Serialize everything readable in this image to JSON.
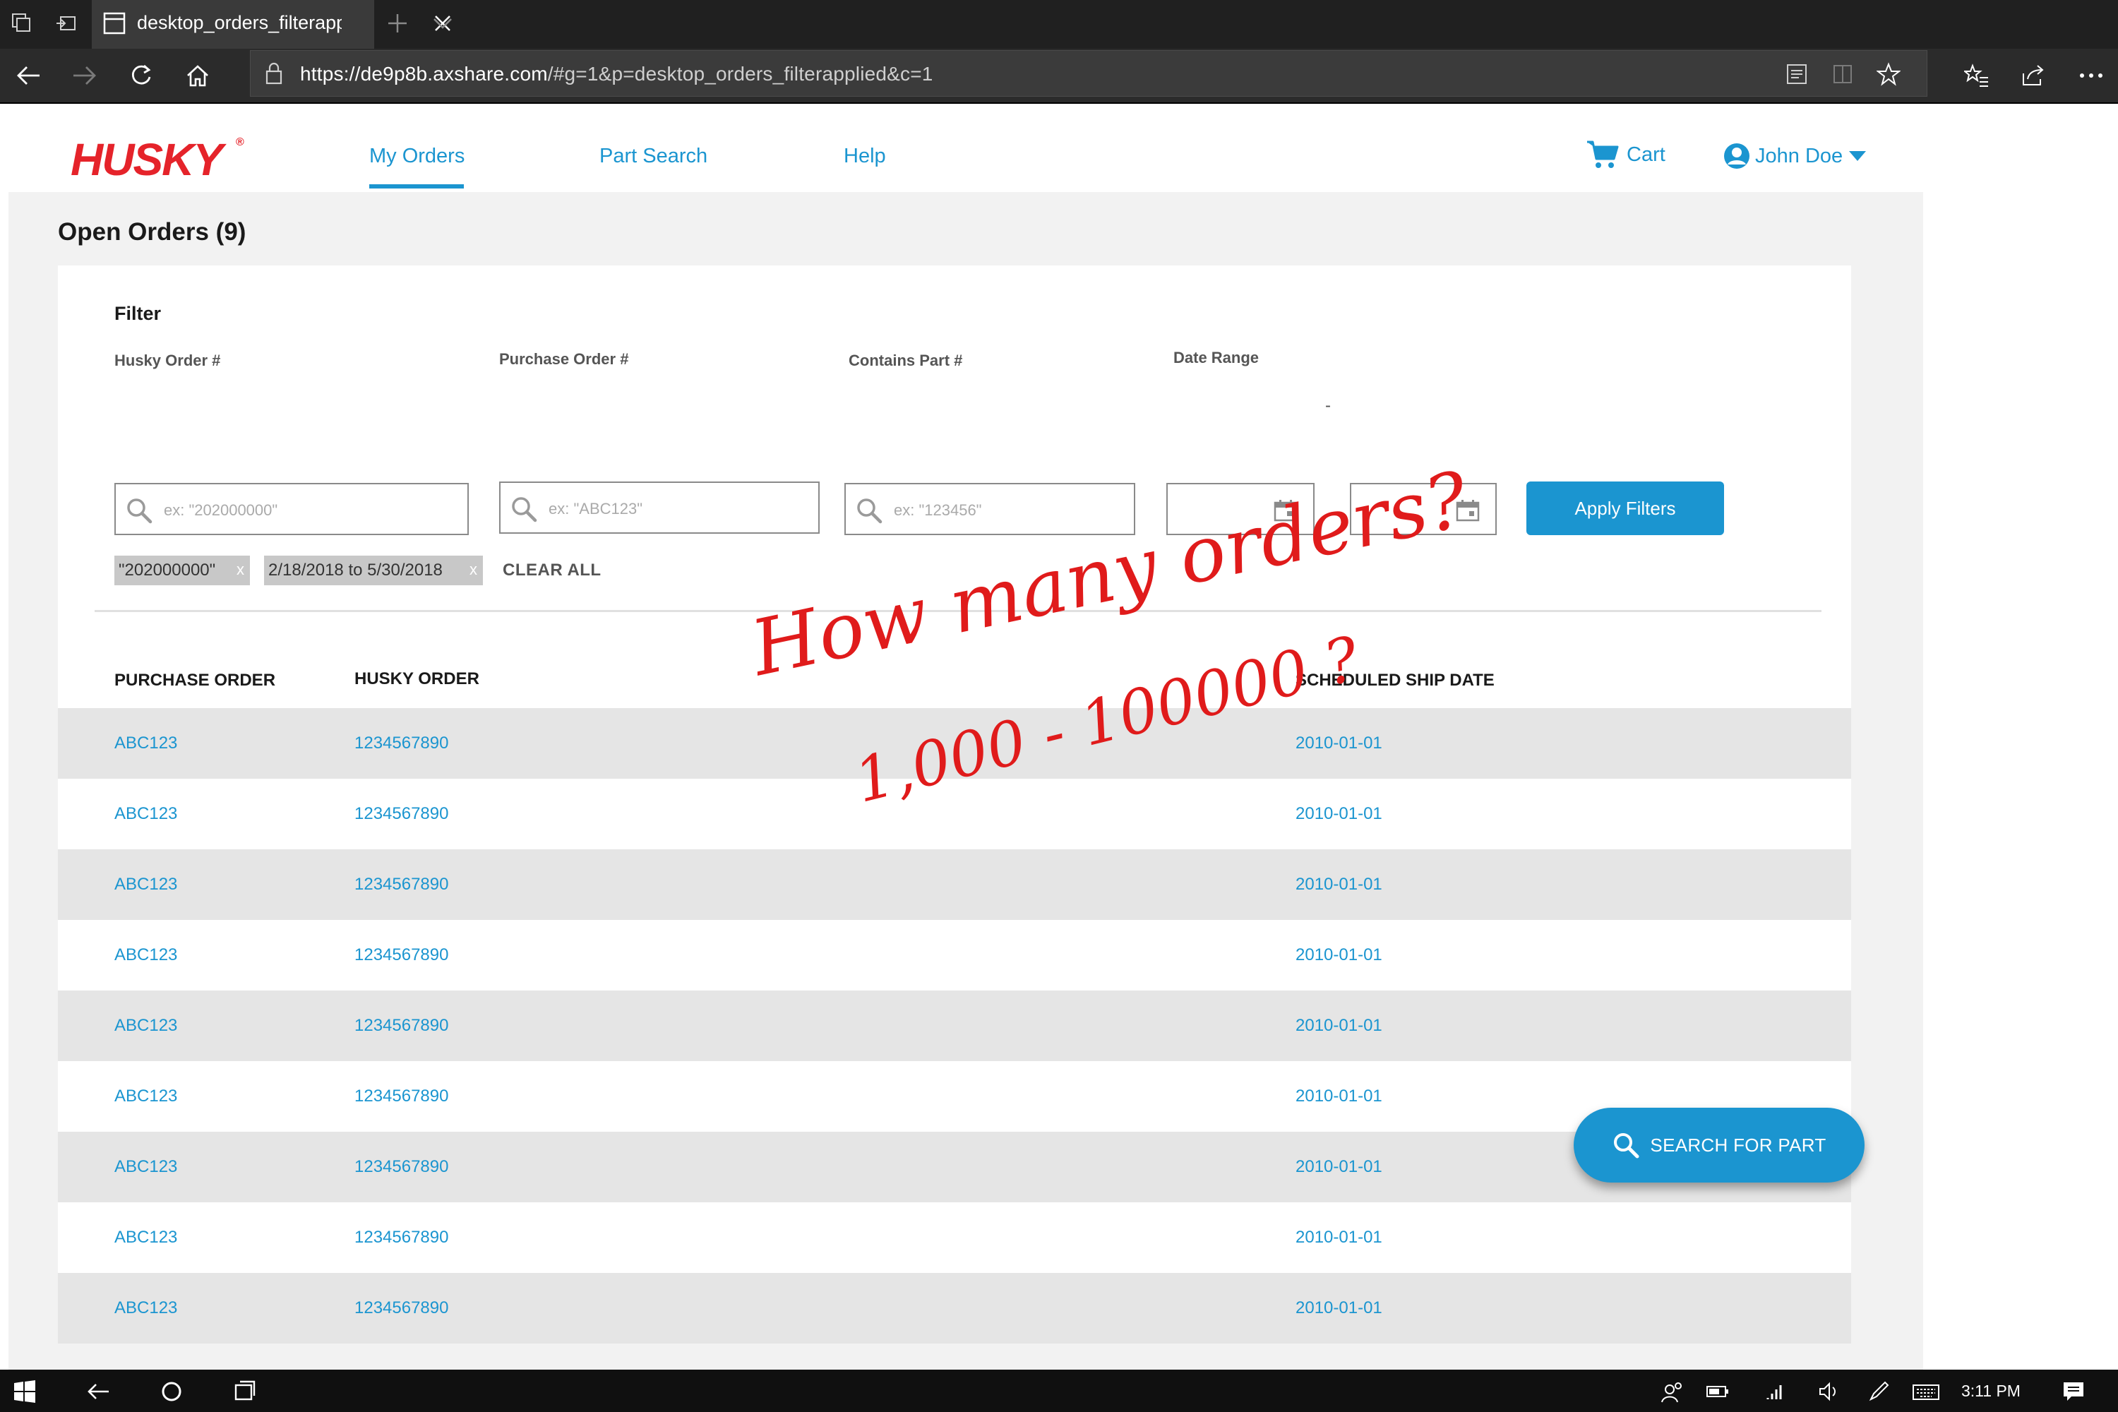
{
  "browser": {
    "tab_title": "desktop_orders_filterapp",
    "url_host": "https://de9p8b.axshare.com",
    "url_rest": "/#g=1&p=desktop_orders_filterapplied&c=1"
  },
  "header": {
    "logo": "HUSKY",
    "logo_mark": "®",
    "nav": [
      "My Orders",
      "Part Search",
      "Help"
    ],
    "active_nav": "My Orders",
    "cart_label": "Cart",
    "user_name": "John Doe"
  },
  "page": {
    "title": "Open Orders (9)"
  },
  "filter": {
    "title": "Filter",
    "husky_order_label": "Husky Order #",
    "husky_order_placeholder": "ex: \"202000000\"",
    "purchase_order_label": "Purchase Order #",
    "purchase_order_placeholder": "ex: \"ABC123\"",
    "contains_part_label": "Contains Part #",
    "contains_part_placeholder": "ex: \"123456\"",
    "date_range_label": "Date Range",
    "date_separator": "-",
    "apply_label": "Apply Filters",
    "chips": [
      {
        "label": "\"202000000\"",
        "remove": "x"
      },
      {
        "label": "2/18/2018 to 5/30/2018",
        "remove": "x"
      }
    ],
    "clear_all": "CLEAR ALL"
  },
  "table": {
    "headers": [
      "PURCHASE ORDER",
      "HUSKY ORDER",
      "SCHEDULED SHIP DATE"
    ],
    "rows": [
      [
        "ABC123",
        "1234567890",
        "2010-01-01"
      ],
      [
        "ABC123",
        "1234567890",
        "2010-01-01"
      ],
      [
        "ABC123",
        "1234567890",
        "2010-01-01"
      ],
      [
        "ABC123",
        "1234567890",
        "2010-01-01"
      ],
      [
        "ABC123",
        "1234567890",
        "2010-01-01"
      ],
      [
        "ABC123",
        "1234567890",
        "2010-01-01"
      ],
      [
        "ABC123",
        "1234567890",
        "2010-01-01"
      ],
      [
        "ABC123",
        "1234567890",
        "2010-01-01"
      ],
      [
        "ABC123",
        "1234567890",
        "2010-01-01"
      ]
    ]
  },
  "fab": {
    "label": "SEARCH FOR PART"
  },
  "annotation": {
    "line1": "How many orders?",
    "line2": "1,000 - 100000 ?"
  },
  "taskbar": {
    "time": "3:11 PM"
  },
  "colors": {
    "accent": "#1b95d0",
    "brand": "#e5232a",
    "annotation": "#e01b1b",
    "row_shade": "#e5e5e5"
  },
  "icons": [
    "search-icon",
    "calendar-icon",
    "cart-icon",
    "user-icon",
    "chevron-down-icon",
    "lock-icon",
    "back-icon",
    "forward-icon",
    "refresh-icon",
    "home-icon",
    "star-icon",
    "share-icon",
    "more-icon",
    "windows-icon"
  ]
}
